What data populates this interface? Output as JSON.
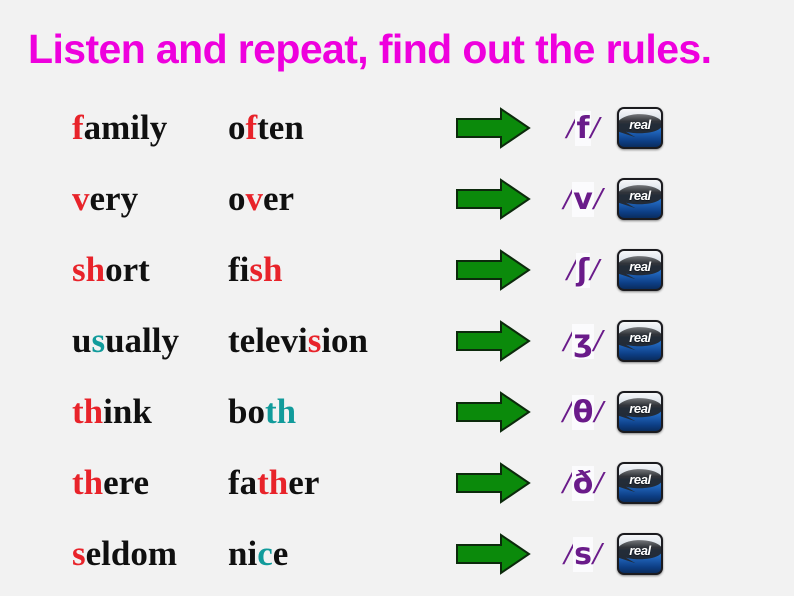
{
  "slide": {
    "title": "Listen and repeat, find out the rules.",
    "title_color": "#ee00dd",
    "background_color": "#f2f2f2",
    "highlight_red": "#e8232a",
    "highlight_teal": "#119b9b",
    "phoneme_color": "#6a1b8a",
    "arrow_color": "#0b8a0b"
  },
  "icons": {
    "arrow": "green-right-arrow-icon",
    "player": "realplayer-icon",
    "player_label": "real"
  },
  "rows": [
    {
      "word_a": {
        "pre": "",
        "hl": "f",
        "post": "amily",
        "hl_color": "red"
      },
      "word_b": {
        "pre": "o",
        "hl": "f",
        "post": "ten",
        "hl_color": "red"
      },
      "phoneme": "f",
      "phoneme_display": "/f/"
    },
    {
      "word_a": {
        "pre": "",
        "hl": "v",
        "post": "ery",
        "hl_color": "red"
      },
      "word_b": {
        "pre": "o",
        "hl": "v",
        "post": "er",
        "hl_color": "red"
      },
      "phoneme": "v",
      "phoneme_display": "/v/"
    },
    {
      "word_a": {
        "pre": "",
        "hl": "sh",
        "post": "ort",
        "hl_color": "red"
      },
      "word_b": {
        "pre": "fi",
        "hl": "sh",
        "post": "",
        "hl_color": "red"
      },
      "phoneme": "ʃ",
      "phoneme_display": "/ʃ/"
    },
    {
      "word_a": {
        "pre": "u",
        "hl": "s",
        "post": "ually",
        "hl_color": "teal"
      },
      "word_b": {
        "pre": "televi",
        "hl": "s",
        "post": "ion",
        "hl_color": "red"
      },
      "phoneme": "ʒ",
      "phoneme_display": "/ʒ/"
    },
    {
      "word_a": {
        "pre": "",
        "hl": "th",
        "post": "ink",
        "hl_color": "red"
      },
      "word_b": {
        "pre": "bo",
        "hl": "th",
        "post": "",
        "hl_color": "teal"
      },
      "phoneme": "θ",
      "phoneme_display": "/θ/"
    },
    {
      "word_a": {
        "pre": "",
        "hl": "th",
        "post": "ere",
        "hl_color": "red"
      },
      "word_b": {
        "pre": "fa",
        "hl": "th",
        "post": "er",
        "hl_color": "red"
      },
      "phoneme": "ð",
      "phoneme_display": "/ð/"
    },
    {
      "word_a": {
        "pre": "",
        "hl": "s",
        "post": "eldom",
        "hl_color": "red"
      },
      "word_b": {
        "pre": "ni",
        "hl": "c",
        "post": "e",
        "hl_color": "teal"
      },
      "phoneme": "s",
      "phoneme_display": "/s/"
    }
  ]
}
